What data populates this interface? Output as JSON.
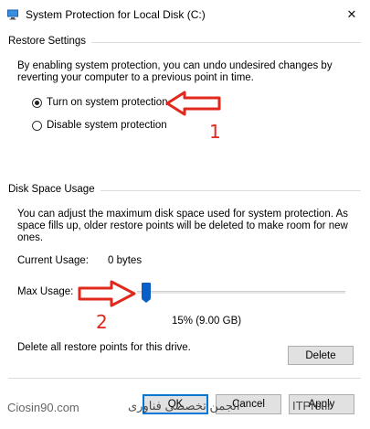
{
  "window": {
    "title": "System Protection for Local Disk (C:)",
    "close_glyph": "✕"
  },
  "restore": {
    "group_title": "Restore Settings",
    "description_line1": "By enabling system protection, you can undo undesired changes by",
    "description_line2": "reverting your computer to a previous point in time.",
    "options": [
      {
        "label": "Turn on system protection",
        "checked": true
      },
      {
        "label": "Disable system protection",
        "checked": false
      }
    ]
  },
  "disk": {
    "group_title": "Disk Space Usage",
    "description_line1": "You can adjust the maximum disk space used for system protection. As",
    "description_line2": "space fills up, older restore points will be deleted to make room for new",
    "description_line3": "ones.",
    "current_usage_label": "Current Usage:",
    "current_usage_value": "0 bytes",
    "max_usage_label": "Max Usage:",
    "max_usage_value": "15% (9.00 GB)",
    "max_usage_percent": 15,
    "delete_text": "Delete all restore points for this drive.",
    "delete_button": "Delete"
  },
  "footer": {
    "ok": "OK",
    "cancel": "Cancel",
    "apply": "Apply"
  },
  "annotations": {
    "num1": "1",
    "num2": "2",
    "arrow_color": "#e0281c"
  },
  "watermark": {
    "left": "Ciosin90.com",
    "middle": "انجمن تخصصی فناوری",
    "right": "ITPro.ir"
  },
  "colors": {
    "accent": "#0078d7",
    "thumb": "#0a5fc7"
  }
}
